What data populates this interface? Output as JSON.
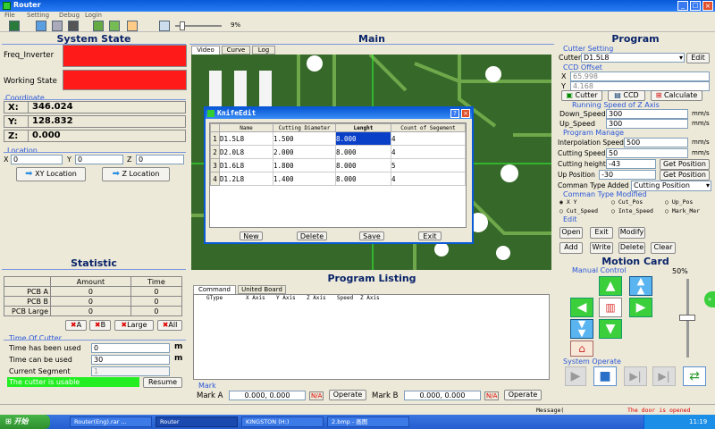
{
  "window": {
    "title": "Router",
    "controls": [
      "_",
      "□",
      "×"
    ]
  },
  "menu": [
    "File",
    "Setting",
    "Debug",
    "Login"
  ],
  "toolbar": {
    "percent": "9%",
    "slider_value": 0.1
  },
  "panels": {
    "system_state": "System State",
    "main": "Main",
    "program": "Program",
    "statistic": "Statistic",
    "program_listing": "Program Listing",
    "motion_card": "Motion Card"
  },
  "state": {
    "freq_label": "Freq_Inverter",
    "working_label": "Working State",
    "status_color": "#ff1a1a"
  },
  "coordinate": {
    "label": "Coordinate",
    "x_label": "X:",
    "x": "346.024",
    "y_label": "Y:",
    "y": "128.832",
    "z_label": "Z:",
    "z": "0.000"
  },
  "location": {
    "label": "Location",
    "x_label": "X",
    "x": "0",
    "y_label": "Y",
    "y": "0",
    "z_label": "Z",
    "z": "0",
    "xy_button": "XY Location",
    "z_button": "Z Location"
  },
  "main_tabs": [
    "Video",
    "Curve",
    "Log"
  ],
  "knife": {
    "title": "KnifeEdit",
    "columns": [
      "Name",
      "Cutting Diameter",
      "Lenght",
      "Count of Segement"
    ],
    "rows": [
      {
        "n": "1",
        "name": "D1.5L8",
        "d": "1.500",
        "l": "8.000",
        "c": "4"
      },
      {
        "n": "2",
        "name": "D2.0L8",
        "d": "2.000",
        "l": "8.000",
        "c": "4"
      },
      {
        "n": "3",
        "name": "D1.6L8",
        "d": "1.800",
        "l": "8.000",
        "c": "5"
      },
      {
        "n": "4",
        "name": "D1.2L8",
        "d": "1.400",
        "l": "8.000",
        "c": "4"
      }
    ],
    "buttons": [
      "New",
      "Delete",
      "Save",
      "Exit"
    ]
  },
  "statistic": {
    "cols": [
      "Amount",
      "Time"
    ],
    "rows": [
      {
        "name": "PCB A",
        "amount": "0",
        "time": "0"
      },
      {
        "name": "PCB B",
        "amount": "0",
        "time": "0"
      },
      {
        "name": "PCB Large",
        "amount": "0",
        "time": "0"
      }
    ],
    "reset_buttons": [
      "A",
      "B",
      "Large",
      "All"
    ]
  },
  "cutter_time": {
    "label": "Time Of Cutter",
    "used_label": "Time has been used",
    "used": "0",
    "can_label": "Time can be used",
    "can": "30",
    "unit": "m",
    "seg_label": "Current Segment",
    "seg": "1",
    "status": "The cutter is usable",
    "resume": "Resume"
  },
  "listing": {
    "tabs": [
      "Command",
      "United Board"
    ],
    "columns": [
      "GType",
      "X Axis",
      "Y Axis",
      "Z Axis",
      "Speed",
      "Z Axis"
    ],
    "mark_label": "Mark",
    "mark_a_label": "Mark A",
    "mark_a": "0.000, 0.000",
    "mark_b_label": "Mark B",
    "mark_b": "0.000, 0.000",
    "na": "N/A",
    "operate": "Operate"
  },
  "program": {
    "cutter_setting": "Cutter Setting",
    "cutter_label": "Cutter",
    "cutter_value": "D1.5L8",
    "edit": "Edit",
    "ccd_offset": "CCD Offset",
    "ccd_x_label": "X",
    "ccd_x": "65.998",
    "ccd_y_label": "Y",
    "ccd_y": "4.168",
    "cutter_btn": "Cutter",
    "ccd_btn": "CCD",
    "calc_btn": "Calculate",
    "running_speed": "Running Speed of Z Axis",
    "down_label": "Down_Speed",
    "down": "300",
    "up_label": "Up_Speed",
    "up": "300",
    "unit_mms": "mm/s",
    "unit_mm": "mm",
    "program_manage": "Program Manage",
    "interp_label": "Interpolation Speed",
    "interp": "500",
    "cutting_speed_label": "Cutting Speed",
    "cutting_speed": "50",
    "height_label": "Cutting height",
    "height": "-43",
    "up_pos_label": "Up Position",
    "up_pos": "-30",
    "get_pos": "Get Position",
    "type_added_label": "Comman Type Added",
    "type_added": "Cutting Position",
    "type_modified": "Comman Type Modified",
    "radios": [
      "X Y",
      "Cut_Pos",
      "Up_Pos",
      "Cut_Speed",
      "Inte_Speed",
      "Mark_Mer"
    ],
    "edit_label": "Edit",
    "edit_buttons": [
      "Open",
      "Exit",
      "Modify",
      "Add",
      "Write",
      "Delete",
      "Clear"
    ]
  },
  "motion": {
    "manual_label": "Manual Control",
    "percent": "50%",
    "speed_level": 0.5,
    "system_operate": "System Operate"
  },
  "status": {
    "message": "Message(",
    "door": "The door is opened"
  },
  "taskbar": {
    "start": "开始",
    "items": [
      "Router(Eng).rar ...",
      "Router",
      "KINGSTON (H:)",
      "2.bmp - 画图"
    ],
    "clock": "11:19"
  }
}
